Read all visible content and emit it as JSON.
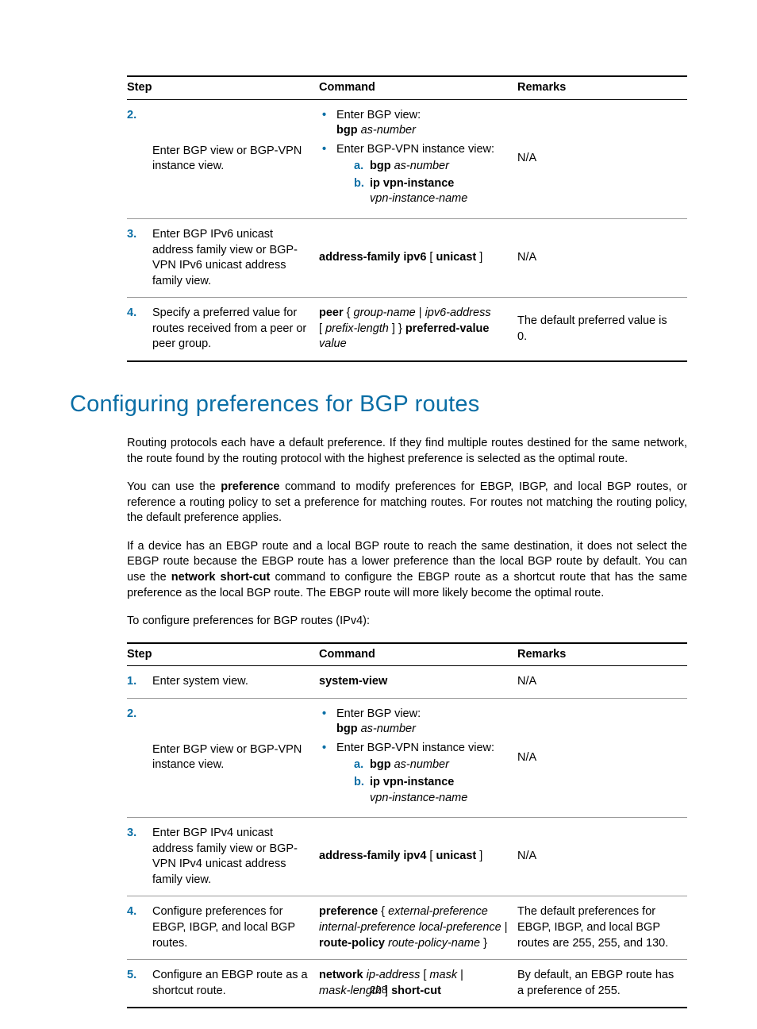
{
  "table1": {
    "headers": {
      "step": "Step",
      "command": "Command",
      "remarks": "Remarks"
    },
    "rows": {
      "r2": {
        "num": "2.",
        "step": "Enter BGP view or BGP-VPN instance view.",
        "cmd_bullet1_line1": "Enter BGP view:",
        "cmd_bullet1_bold": "bgp",
        "cmd_bullet1_ital": " as-number",
        "cmd_bullet2_line1": "Enter BGP-VPN instance view:",
        "cmd_bullet2_a_bold": "bgp",
        "cmd_bullet2_a_ital": " as-number",
        "cmd_bullet2_b_bold": "ip vpn-instance",
        "cmd_bullet2_b_ital": "vpn-instance-name",
        "remarks": "N/A"
      },
      "r3": {
        "num": "3.",
        "step": "Enter BGP IPv6 unicast address family view or BGP-VPN IPv6 unicast address family view.",
        "cmd_bold": "address-family ipv6",
        "cmd_rest": " [ ",
        "cmd_bold2": "unicast",
        "cmd_rest2": " ]",
        "remarks": "N/A"
      },
      "r4": {
        "num": "4.",
        "step": "Specify a preferred value for routes received from a peer or peer group.",
        "cmd_p1_bold": "peer",
        "cmd_p1_txt": " { ",
        "cmd_p1_ital1": "group-name",
        "cmd_p1_txt2": " | ",
        "cmd_p1_ital2": "ipv6-address",
        "cmd_p2_txt": " [ ",
        "cmd_p2_ital": "prefix-length",
        "cmd_p2_txt2": " ] } ",
        "cmd_p2_bold": "preferred-value",
        "cmd_p3_ital": "value",
        "remarks": "The default preferred value is 0."
      }
    }
  },
  "heading": "Configuring preferences for BGP routes",
  "para1": "Routing protocols each have a default preference. If they find multiple routes destined for the same network, the route found by the routing protocol with the highest preference is selected as the optimal route.",
  "para2_pre": "You can use the ",
  "para2_bold": "preference",
  "para2_post": " command to modify preferences for EBGP, IBGP, and local BGP routes, or reference a routing policy to set a preference for matching routes. For routes not matching the routing policy, the default preference applies.",
  "para3_pre": "If a device has an EBGP route and a local BGP route to reach the same destination, it does not select the EBGP route because the EBGP route has a lower preference than the local BGP route by default. You can use the ",
  "para3_bold": "network short-cut",
  "para3_post": " command to configure the EBGP route as a shortcut route that has the same preference as the local BGP route. The EBGP route will more likely become the optimal route.",
  "intro2": "To configure preferences for BGP routes (IPv4):",
  "table2": {
    "headers": {
      "step": "Step",
      "command": "Command",
      "remarks": "Remarks"
    },
    "rows": {
      "r1": {
        "num": "1.",
        "step": "Enter system view.",
        "cmd_bold": "system-view",
        "remarks": "N/A"
      },
      "r2": {
        "num": "2.",
        "step": "Enter BGP view or BGP-VPN instance view.",
        "cmd_bullet1_line1": "Enter BGP view:",
        "cmd_bullet1_bold": "bgp",
        "cmd_bullet1_ital": " as-number",
        "cmd_bullet2_line1": "Enter BGP-VPN instance view:",
        "cmd_bullet2_a_bold": "bgp",
        "cmd_bullet2_a_ital": " as-number",
        "cmd_bullet2_b_bold": "ip vpn-instance",
        "cmd_bullet2_b_ital": "vpn-instance-name",
        "remarks": "N/A"
      },
      "r3": {
        "num": "3.",
        "step": "Enter BGP IPv4 unicast address family view or BGP-VPN IPv4 unicast address family view.",
        "cmd_bold": "address-family ipv4",
        "cmd_rest": " [ ",
        "cmd_bold2": "unicast",
        "cmd_rest2": " ]",
        "remarks": "N/A"
      },
      "r4": {
        "num": "4.",
        "step": "Configure preferences for EBGP, IBGP, and local BGP routes.",
        "cmd_l1_bold": "preference",
        "cmd_l1_txt": " { ",
        "cmd_l1_ital": "external-preference internal-preference local-preference",
        "cmd_l1_txt2": " | ",
        "cmd_l1_bold2": "route-policy",
        "cmd_l2_ital": "route-policy-name",
        "cmd_l2_txt": " }",
        "remarks": "The default preferences for EBGP, IBGP, and local BGP routes are 255, 255, and 130."
      },
      "r5": {
        "num": "5.",
        "step": "Configure an EBGP route as a shortcut route.",
        "cmd_bold1": "network",
        "cmd_ital1": " ip-address",
        "cmd_txt1": " [ ",
        "cmd_ital2": "mask",
        "cmd_txt2": " | ",
        "cmd_ital3": "mask-length",
        "cmd_txt3": " ] ",
        "cmd_bold2": "short-cut",
        "remarks": "By default, an EBGP route has a preference of 255."
      }
    }
  },
  "labels": {
    "a": "a.",
    "b": "b."
  },
  "pagenum": "228"
}
